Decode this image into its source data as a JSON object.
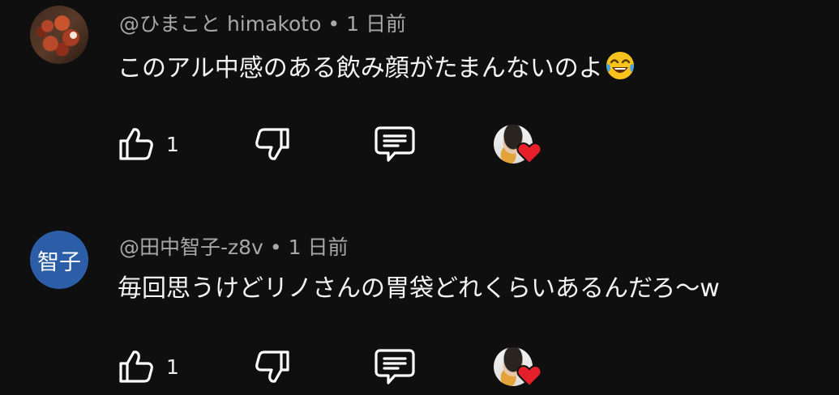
{
  "comments": [
    {
      "author": "@ひまこと himakoto",
      "separator": "•",
      "time": "1 日前",
      "text": "このアル中感のある飲み顔がたまんないのよ",
      "emoji_icon": "rolling-laughing-emoji-icon",
      "likes": "1",
      "avatar_type": "photo"
    },
    {
      "author": "@田中智子-z8v",
      "separator": "•",
      "time": "1 日前",
      "text": "毎回思うけどリノさんの胃袋どれくらいあるんだろ〜w",
      "likes": "1",
      "avatar_type": "initials",
      "avatar_initials": "智子",
      "avatar_color": "#2b5ea7"
    }
  ],
  "icons": {
    "like": "thumbs-up-icon",
    "dislike": "thumbs-down-icon",
    "reply": "reply-comment-icon",
    "creator_heart": "creator-heart-icon"
  },
  "colors": {
    "background": "#0f0f0f",
    "heart": "#e6202a",
    "meta_text": "#a8a8a8"
  }
}
